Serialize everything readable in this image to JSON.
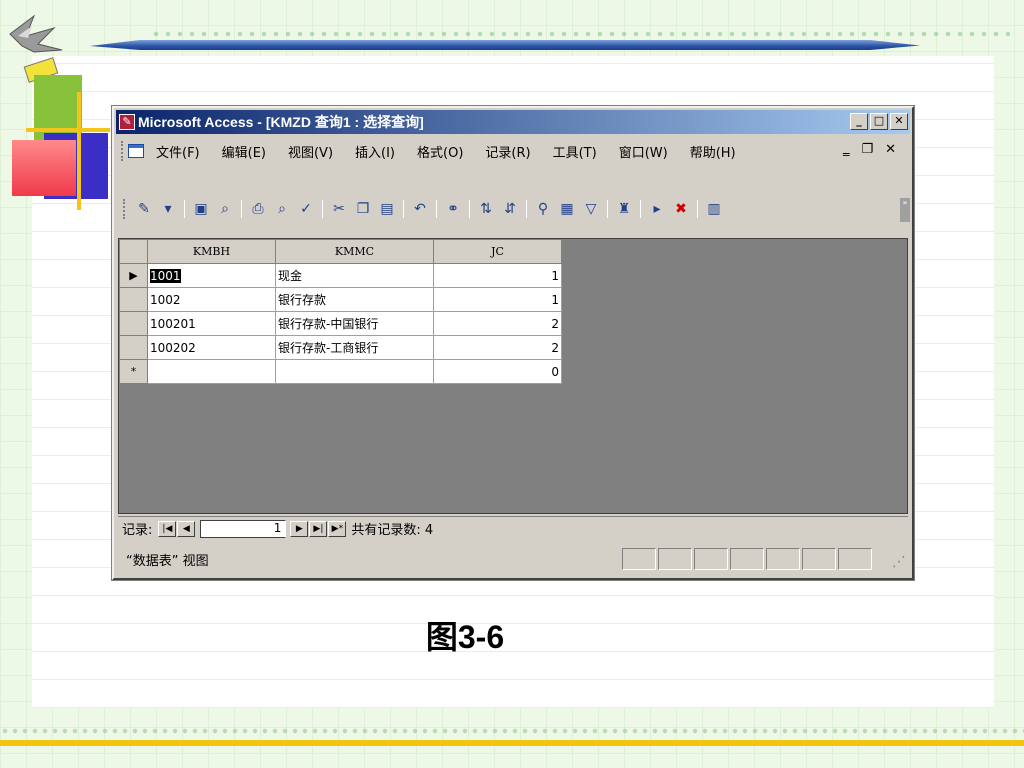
{
  "window": {
    "title": "Microsoft Access - [KMZD 查询1 : 选择查询]",
    "app_icon": "access-icon"
  },
  "menu": {
    "items": [
      "文件(F)",
      "编辑(E)",
      "视图(V)",
      "插入(I)",
      "格式(O)",
      "记录(R)",
      "工具(T)",
      "窗口(W)",
      "帮助(H)"
    ]
  },
  "datasheet": {
    "columns": [
      "KMBH",
      "KMMC",
      "JC"
    ],
    "rows": [
      {
        "selector": "▶",
        "kmbh": "1001",
        "kmmc": "现金",
        "jc": "1"
      },
      {
        "selector": "",
        "kmbh": "1002",
        "kmmc": "银行存款",
        "jc": "1"
      },
      {
        "selector": "",
        "kmbh": "100201",
        "kmmc": "银行存款-中国银行",
        "jc": "2"
      },
      {
        "selector": "",
        "kmbh": "100202",
        "kmmc": "银行存款-工商银行",
        "jc": "2"
      },
      {
        "selector": "*",
        "kmbh": "",
        "kmmc": "",
        "jc": "0"
      }
    ]
  },
  "nav": {
    "label": "记录:",
    "current": "1",
    "total_label": "共有记录数: 4"
  },
  "status": {
    "text": "“数据表” 视图"
  },
  "caption": "图3-6",
  "colors": {
    "titlebar_start": "#0a246a",
    "titlebar_end": "#a6caf0",
    "chrome": "#d4d0c8",
    "datasheet_bg": "#808080",
    "accent_yellow": "#f2c30f"
  }
}
